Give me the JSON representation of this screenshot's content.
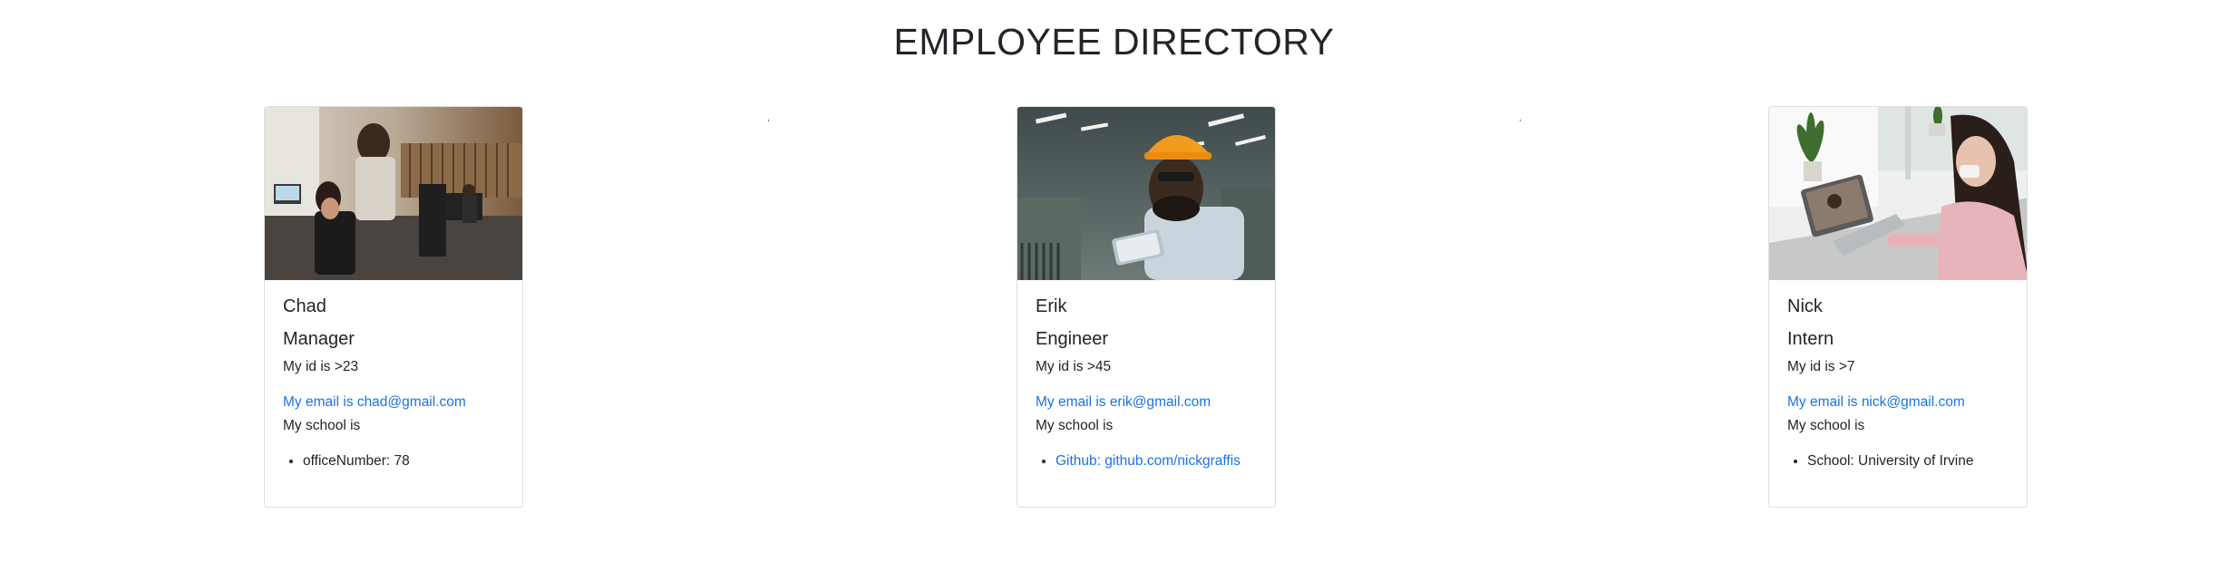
{
  "page": {
    "title": "EMPLOYEE DIRECTORY",
    "stray_marks": [
      ",",
      ","
    ]
  },
  "employees": [
    {
      "name": "Chad",
      "role": "Manager",
      "id_text": "My id is >23",
      "email_text": "My email is chad@gmail.com",
      "school_text": "My school is",
      "extra": "officeNumber: 78",
      "extra_is_link": false
    },
    {
      "name": "Erik",
      "role": "Engineer",
      "id_text": "My id is >45",
      "email_text": "My email is erik@gmail.com",
      "school_text": "My school is",
      "extra": "Github: github.com/nickgraffis",
      "extra_is_link": true
    },
    {
      "name": "Nick",
      "role": "Intern",
      "id_text": "My id is >7",
      "email_text": "My email is nick@gmail.com",
      "school_text": "My school is",
      "extra": "School: University of Irvine",
      "extra_is_link": false
    }
  ],
  "colors": {
    "link": "#1a73e8",
    "text": "#212529"
  }
}
